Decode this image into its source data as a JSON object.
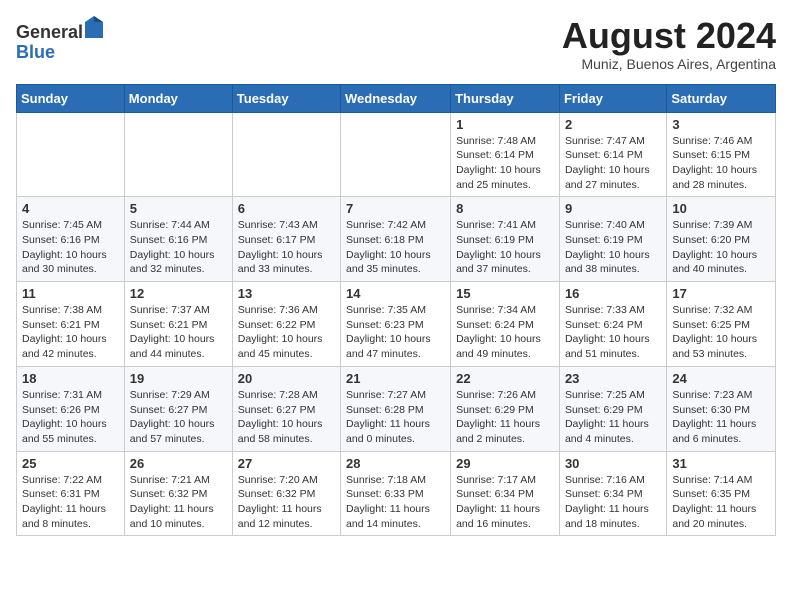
{
  "header": {
    "logo_general": "General",
    "logo_blue": "Blue",
    "title": "August 2024",
    "location": "Muniz, Buenos Aires, Argentina"
  },
  "calendar": {
    "days_of_week": [
      "Sunday",
      "Monday",
      "Tuesday",
      "Wednesday",
      "Thursday",
      "Friday",
      "Saturday"
    ],
    "weeks": [
      [
        {
          "day": "",
          "sunrise": "",
          "sunset": "",
          "daylight": ""
        },
        {
          "day": "",
          "sunrise": "",
          "sunset": "",
          "daylight": ""
        },
        {
          "day": "",
          "sunrise": "",
          "sunset": "",
          "daylight": ""
        },
        {
          "day": "",
          "sunrise": "",
          "sunset": "",
          "daylight": ""
        },
        {
          "day": "1",
          "sunrise": "Sunrise: 7:48 AM",
          "sunset": "Sunset: 6:14 PM",
          "daylight": "Daylight: 10 hours and 25 minutes."
        },
        {
          "day": "2",
          "sunrise": "Sunrise: 7:47 AM",
          "sunset": "Sunset: 6:14 PM",
          "daylight": "Daylight: 10 hours and 27 minutes."
        },
        {
          "day": "3",
          "sunrise": "Sunrise: 7:46 AM",
          "sunset": "Sunset: 6:15 PM",
          "daylight": "Daylight: 10 hours and 28 minutes."
        }
      ],
      [
        {
          "day": "4",
          "sunrise": "Sunrise: 7:45 AM",
          "sunset": "Sunset: 6:16 PM",
          "daylight": "Daylight: 10 hours and 30 minutes."
        },
        {
          "day": "5",
          "sunrise": "Sunrise: 7:44 AM",
          "sunset": "Sunset: 6:16 PM",
          "daylight": "Daylight: 10 hours and 32 minutes."
        },
        {
          "day": "6",
          "sunrise": "Sunrise: 7:43 AM",
          "sunset": "Sunset: 6:17 PM",
          "daylight": "Daylight: 10 hours and 33 minutes."
        },
        {
          "day": "7",
          "sunrise": "Sunrise: 7:42 AM",
          "sunset": "Sunset: 6:18 PM",
          "daylight": "Daylight: 10 hours and 35 minutes."
        },
        {
          "day": "8",
          "sunrise": "Sunrise: 7:41 AM",
          "sunset": "Sunset: 6:19 PM",
          "daylight": "Daylight: 10 hours and 37 minutes."
        },
        {
          "day": "9",
          "sunrise": "Sunrise: 7:40 AM",
          "sunset": "Sunset: 6:19 PM",
          "daylight": "Daylight: 10 hours and 38 minutes."
        },
        {
          "day": "10",
          "sunrise": "Sunrise: 7:39 AM",
          "sunset": "Sunset: 6:20 PM",
          "daylight": "Daylight: 10 hours and 40 minutes."
        }
      ],
      [
        {
          "day": "11",
          "sunrise": "Sunrise: 7:38 AM",
          "sunset": "Sunset: 6:21 PM",
          "daylight": "Daylight: 10 hours and 42 minutes."
        },
        {
          "day": "12",
          "sunrise": "Sunrise: 7:37 AM",
          "sunset": "Sunset: 6:21 PM",
          "daylight": "Daylight: 10 hours and 44 minutes."
        },
        {
          "day": "13",
          "sunrise": "Sunrise: 7:36 AM",
          "sunset": "Sunset: 6:22 PM",
          "daylight": "Daylight: 10 hours and 45 minutes."
        },
        {
          "day": "14",
          "sunrise": "Sunrise: 7:35 AM",
          "sunset": "Sunset: 6:23 PM",
          "daylight": "Daylight: 10 hours and 47 minutes."
        },
        {
          "day": "15",
          "sunrise": "Sunrise: 7:34 AM",
          "sunset": "Sunset: 6:24 PM",
          "daylight": "Daylight: 10 hours and 49 minutes."
        },
        {
          "day": "16",
          "sunrise": "Sunrise: 7:33 AM",
          "sunset": "Sunset: 6:24 PM",
          "daylight": "Daylight: 10 hours and 51 minutes."
        },
        {
          "day": "17",
          "sunrise": "Sunrise: 7:32 AM",
          "sunset": "Sunset: 6:25 PM",
          "daylight": "Daylight: 10 hours and 53 minutes."
        }
      ],
      [
        {
          "day": "18",
          "sunrise": "Sunrise: 7:31 AM",
          "sunset": "Sunset: 6:26 PM",
          "daylight": "Daylight: 10 hours and 55 minutes."
        },
        {
          "day": "19",
          "sunrise": "Sunrise: 7:29 AM",
          "sunset": "Sunset: 6:27 PM",
          "daylight": "Daylight: 10 hours and 57 minutes."
        },
        {
          "day": "20",
          "sunrise": "Sunrise: 7:28 AM",
          "sunset": "Sunset: 6:27 PM",
          "daylight": "Daylight: 10 hours and 58 minutes."
        },
        {
          "day": "21",
          "sunrise": "Sunrise: 7:27 AM",
          "sunset": "Sunset: 6:28 PM",
          "daylight": "Daylight: 11 hours and 0 minutes."
        },
        {
          "day": "22",
          "sunrise": "Sunrise: 7:26 AM",
          "sunset": "Sunset: 6:29 PM",
          "daylight": "Daylight: 11 hours and 2 minutes."
        },
        {
          "day": "23",
          "sunrise": "Sunrise: 7:25 AM",
          "sunset": "Sunset: 6:29 PM",
          "daylight": "Daylight: 11 hours and 4 minutes."
        },
        {
          "day": "24",
          "sunrise": "Sunrise: 7:23 AM",
          "sunset": "Sunset: 6:30 PM",
          "daylight": "Daylight: 11 hours and 6 minutes."
        }
      ],
      [
        {
          "day": "25",
          "sunrise": "Sunrise: 7:22 AM",
          "sunset": "Sunset: 6:31 PM",
          "daylight": "Daylight: 11 hours and 8 minutes."
        },
        {
          "day": "26",
          "sunrise": "Sunrise: 7:21 AM",
          "sunset": "Sunset: 6:32 PM",
          "daylight": "Daylight: 11 hours and 10 minutes."
        },
        {
          "day": "27",
          "sunrise": "Sunrise: 7:20 AM",
          "sunset": "Sunset: 6:32 PM",
          "daylight": "Daylight: 11 hours and 12 minutes."
        },
        {
          "day": "28",
          "sunrise": "Sunrise: 7:18 AM",
          "sunset": "Sunset: 6:33 PM",
          "daylight": "Daylight: 11 hours and 14 minutes."
        },
        {
          "day": "29",
          "sunrise": "Sunrise: 7:17 AM",
          "sunset": "Sunset: 6:34 PM",
          "daylight": "Daylight: 11 hours and 16 minutes."
        },
        {
          "day": "30",
          "sunrise": "Sunrise: 7:16 AM",
          "sunset": "Sunset: 6:34 PM",
          "daylight": "Daylight: 11 hours and 18 minutes."
        },
        {
          "day": "31",
          "sunrise": "Sunrise: 7:14 AM",
          "sunset": "Sunset: 6:35 PM",
          "daylight": "Daylight: 11 hours and 20 minutes."
        }
      ]
    ]
  }
}
